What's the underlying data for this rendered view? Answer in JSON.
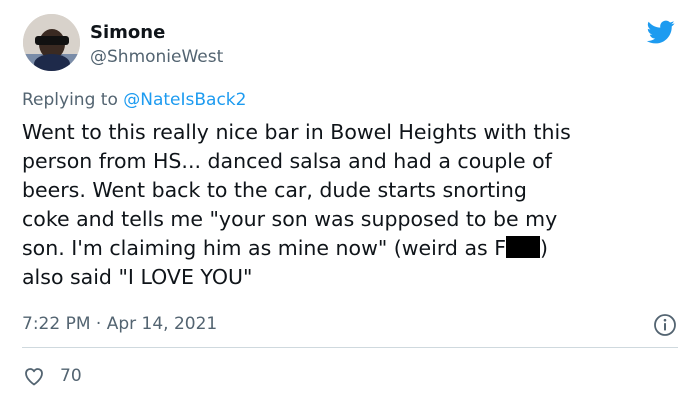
{
  "user": {
    "display_name": "Simone",
    "handle": "@ShmonieWest"
  },
  "reply": {
    "prefix": "Replying to",
    "mention": "@NateIsBack2"
  },
  "tweet": {
    "lines": [
      "Went to this really nice bar in Bowel Heights with this",
      "person from HS... danced salsa and had a couple of",
      "beers. Went back to the car, dude starts snorting",
      "coke and tells me \"your son was supposed to be my",
      "son. I'm claiming him as mine now\" (weird as F",
      ")",
      "also said \"I LOVE YOU\""
    ]
  },
  "meta": {
    "time": "7:22 PM",
    "separator": "·",
    "date": "Apr 14, 2021"
  },
  "actions": {
    "likes": "70"
  },
  "icons": {
    "brand": "twitter-bird-icon",
    "info": "info-icon",
    "like": "heart-icon"
  },
  "colors": {
    "brand": "#1d9bf0",
    "secondary_text": "#536471",
    "primary_text": "#0f1419",
    "divider": "#cfd9de"
  }
}
